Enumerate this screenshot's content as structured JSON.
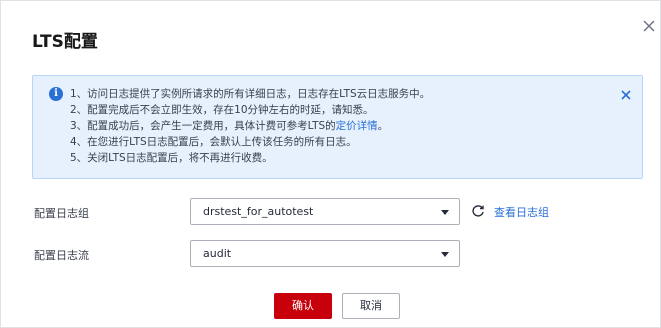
{
  "dialog": {
    "title": "LTS配置",
    "close_icon": "close-icon"
  },
  "notice": {
    "icon": "info-icon",
    "items": [
      "1、访问日志提供了实例所请求的所有详细日志，日志存在LTS云日志服务中。",
      "2、配置完成后不会立即生效，存在10分钟左右的时延，请知悉。",
      "3、配置成功后，会产生一定费用，具体计费可参考LTS的",
      "4、在您进行LTS日志配置后，会默认上传该任务的所有日志。",
      "5、关闭LTS日志配置后，将不再进行收费。"
    ],
    "pricing_link": "定价详情",
    "pricing_suffix": "。"
  },
  "form": {
    "log_group": {
      "label": "配置日志组",
      "value": "drstest_for_autotest",
      "refresh_icon": "refresh-icon",
      "view_link": "查看日志组"
    },
    "log_stream": {
      "label": "配置日志流",
      "value": "audit"
    }
  },
  "footer": {
    "confirm_label": "确认",
    "cancel_label": "取消"
  },
  "colors": {
    "primary": "#c7000b",
    "link": "#2a6fd6",
    "notice_bg": "#e6f1fd",
    "notice_border": "#b7d5fa"
  }
}
